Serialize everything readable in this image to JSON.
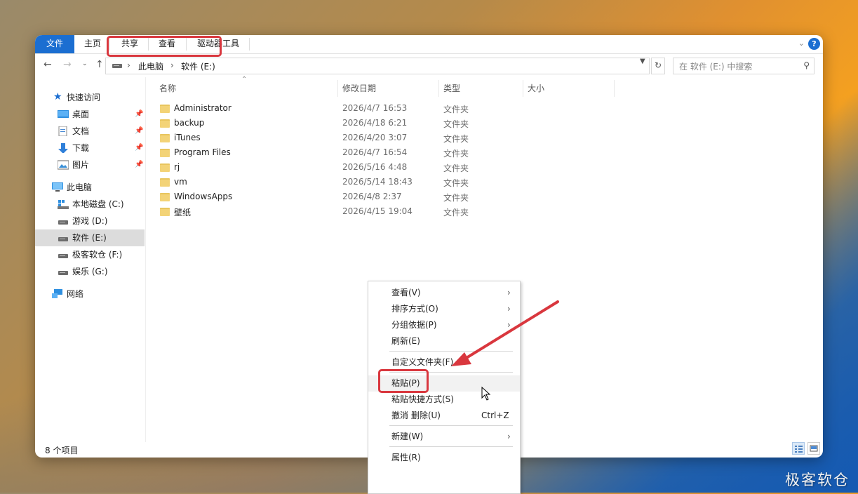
{
  "ribbon": {
    "tabs": [
      "文件",
      "主页",
      "共享",
      "查看",
      "驱动器工具"
    ]
  },
  "nav": {
    "breadcrumb": [
      "此电脑",
      "软件 (E:)"
    ],
    "search_placeholder": "在 软件 (E:) 中搜索"
  },
  "sidebar": {
    "quick_access": "快速访问",
    "quick_items": [
      "桌面",
      "文档",
      "下载",
      "图片"
    ],
    "this_pc": "此电脑",
    "drives": [
      "本地磁盘 (C:)",
      "游戏 (D:)",
      "软件 (E:)",
      "极客软仓 (F:)",
      "娱乐 (G:)"
    ],
    "selected_drive": "软件 (E:)",
    "network": "网络"
  },
  "columns": [
    "名称",
    "修改日期",
    "类型",
    "大小"
  ],
  "files": [
    {
      "name": "Administrator",
      "date": "2026/4/7 16:53",
      "type": "文件夹"
    },
    {
      "name": "backup",
      "date": "2026/4/18 6:21",
      "type": "文件夹"
    },
    {
      "name": "iTunes",
      "date": "2026/4/20 3:07",
      "type": "文件夹"
    },
    {
      "name": "Program Files",
      "date": "2026/4/7 16:54",
      "type": "文件夹"
    },
    {
      "name": "rj",
      "date": "2026/5/16 4:48",
      "type": "文件夹"
    },
    {
      "name": "vm",
      "date": "2026/5/14 18:43",
      "type": "文件夹"
    },
    {
      "name": "WindowsApps",
      "date": "2026/4/8 2:37",
      "type": "文件夹"
    },
    {
      "name": "壁纸",
      "date": "2026/4/15 19:04",
      "type": "文件夹"
    }
  ],
  "status": {
    "item_count": "8 个项目"
  },
  "context_menu": {
    "view": "查看(V)",
    "sort": "排序方式(O)",
    "group": "分组依据(P)",
    "refresh": "刷新(E)",
    "customize": "自定义文件夹(F)...",
    "paste": "粘贴(P)",
    "paste_shortcut": "粘贴快捷方式(S)",
    "undo": "撤消 删除(U)",
    "undo_shortcut": "Ctrl+Z",
    "new": "新建(W)",
    "properties": "属性(R)"
  },
  "watermark": "极客软仓",
  "colors": {
    "accent": "#1b6ed1",
    "highlight": "#d9373e",
    "folder": "#f3d377"
  }
}
